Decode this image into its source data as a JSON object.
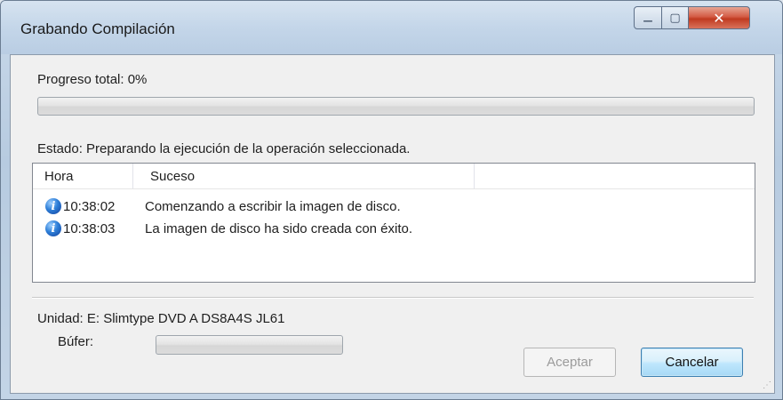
{
  "window": {
    "title": "Grabando Compilación",
    "minimize_glyph": "—",
    "maximize_glyph": "▢",
    "close_glyph": "✕"
  },
  "progress": {
    "label": "Progreso total: 0%",
    "value": 0
  },
  "status": {
    "label": "Estado: Preparando la ejecución de la operación seleccionada."
  },
  "log": {
    "columns": [
      "Hora",
      "Suceso"
    ],
    "rows": [
      {
        "icon": "info-icon",
        "time": "10:38:02",
        "event": "Comenzando a escribir la imagen de disco."
      },
      {
        "icon": "info-icon",
        "time": "10:38:03",
        "event": "La imagen de disco ha sido creada con éxito."
      }
    ]
  },
  "drive": {
    "label": "Unidad: E: Slimtype DVD A DS8A4S JL61",
    "buffer_label": "Búfer:",
    "buffer_value": 0
  },
  "buttons": {
    "accept": "Aceptar",
    "cancel": "Cancelar"
  },
  "colors": {
    "accent": "#3c7fb1",
    "info_icon": "#2e7fd8",
    "close_button": "#c03a20"
  }
}
